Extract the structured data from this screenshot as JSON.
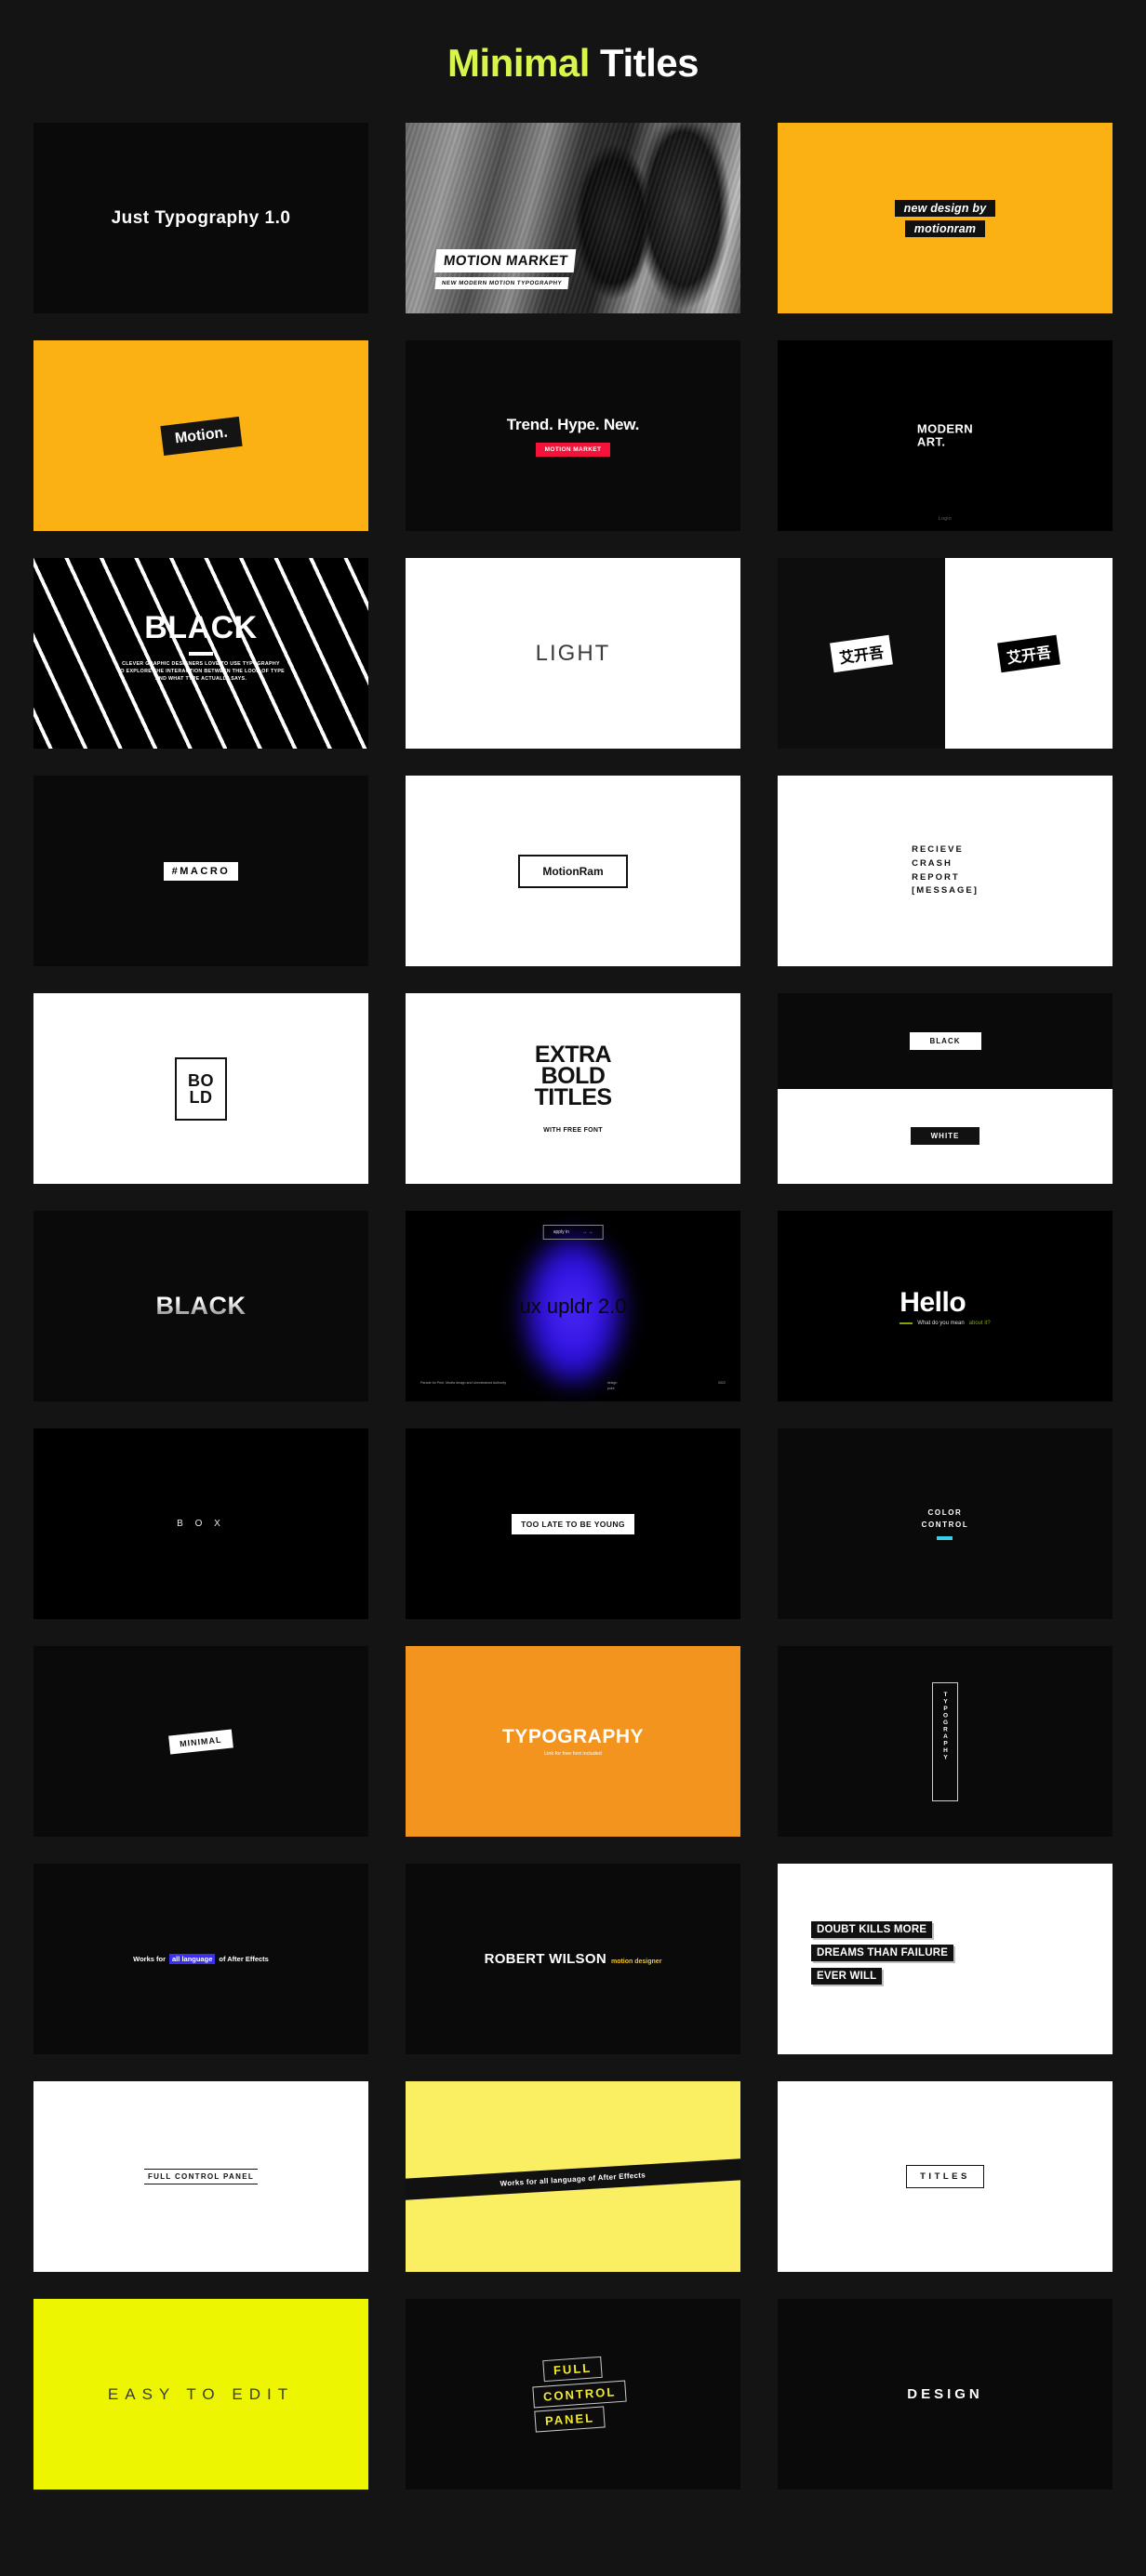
{
  "header": {
    "title_accent": "Minimal",
    "title_rest": " Titles",
    "accent_color": "#d7f54b"
  },
  "cards": [
    {
      "id": "just-typography",
      "text": "Just Typography 1.0",
      "bg": "#0a0a0a"
    },
    {
      "id": "motion-market-photo",
      "title": "MOTION MARKET",
      "subtitle": "NEW MODERN MOTION TYPOGRAPHY"
    },
    {
      "id": "new-design-by-motionram",
      "line1": "new design by",
      "line2": "motionram",
      "bg": "#fbb114"
    },
    {
      "id": "motion-dot",
      "text": "Motion.",
      "bg": "#fbb114"
    },
    {
      "id": "trend-hype-new",
      "title": "Trend. Hype. New.",
      "badge": "MOTION MARKET",
      "badge_color": "#f5133b"
    },
    {
      "id": "modern-art",
      "line1": "MODERN",
      "line2": "ART.",
      "footer": "Login"
    },
    {
      "id": "black-stripes",
      "title": "BLACK",
      "desc_line1": "CLEVER GRAPHIC DESIGNERS LOVE TO USE TYPOGRAPHY",
      "desc_line2": "TO EXPLORE THE INTERACTION BETWEEN THE LOOK OF TYPE",
      "desc_line3": "AND WHAT TYPE ACTUALLY SAYS."
    },
    {
      "id": "light",
      "text": "LIGHT",
      "bg": "#ffffff"
    },
    {
      "id": "cjk-split",
      "text": "艾开吾"
    },
    {
      "id": "macro",
      "text": "#MACRO"
    },
    {
      "id": "motionram-box",
      "text": "MotionRam"
    },
    {
      "id": "crash-report",
      "line1": "RECIEVE",
      "line2": "CRASH",
      "line3": "REPORT",
      "line4": "[MESSAGE]"
    },
    {
      "id": "bold-box",
      "line1": "BO",
      "line2": "LD"
    },
    {
      "id": "extra-bold-titles",
      "line1": "EXTRA",
      "line2": "BOLD",
      "line3": "TITLES",
      "sub": "WITH FREE FONT"
    },
    {
      "id": "black-white-split",
      "top": "BLACK",
      "bottom": "WHITE"
    },
    {
      "id": "black-gradient",
      "text": "BLACK"
    },
    {
      "id": "ux-upldr",
      "headline": "ux upldr 2.0",
      "badge_left": "apply in",
      "badge_right": "→ →",
      "foot_left": "Parade for Print, Media design and Unrestrained Authority",
      "foot_mid_1": "design",
      "foot_mid_2": "point",
      "foot_right": "2022"
    },
    {
      "id": "hello",
      "title": "Hello",
      "sub_plain": "What do you mean",
      "sub_accent": "about it?"
    },
    {
      "id": "box",
      "text": "B O X"
    },
    {
      "id": "too-late",
      "text": "TOO LATE TO BE YOUNG"
    },
    {
      "id": "color-control",
      "line1": "COLOR",
      "line2": "CONTROL",
      "bar_color": "#35d2f0"
    },
    {
      "id": "minimal-tag",
      "text": "MINIMAL"
    },
    {
      "id": "typography-orange",
      "title": "TYPOGRAPHY",
      "sub": "Link for free font included",
      "bg": "#f3941f"
    },
    {
      "id": "typography-vertical",
      "text": "TYPOGRAPHY"
    },
    {
      "id": "works-for-all-language",
      "pre": "Works for",
      "hl": "all language",
      "post": "of After Effects"
    },
    {
      "id": "robert-wilson",
      "name": "ROBERT WILSON",
      "role": "motion designer"
    },
    {
      "id": "doubt-kills",
      "line1": "DOUBT KILLS MORE",
      "line2": "DREAMS THAN FAILURE",
      "line3": "EVER WILL"
    },
    {
      "id": "full-control-panel-underline",
      "text": "FULL CONTROL PANEL"
    },
    {
      "id": "yellow-band",
      "text": "Works for all language of After Effects",
      "bg": "#faee63"
    },
    {
      "id": "titles-box",
      "text": "TITLES"
    },
    {
      "id": "easy-to-edit",
      "text": "EASY TO EDIT",
      "bg": "#eef500"
    },
    {
      "id": "full-control-panel-stack",
      "line1": "FULL",
      "line2": "CONTROL",
      "line3": "PANEL",
      "color": "#f1ea2e"
    },
    {
      "id": "design",
      "text": "DESIGN"
    }
  ]
}
